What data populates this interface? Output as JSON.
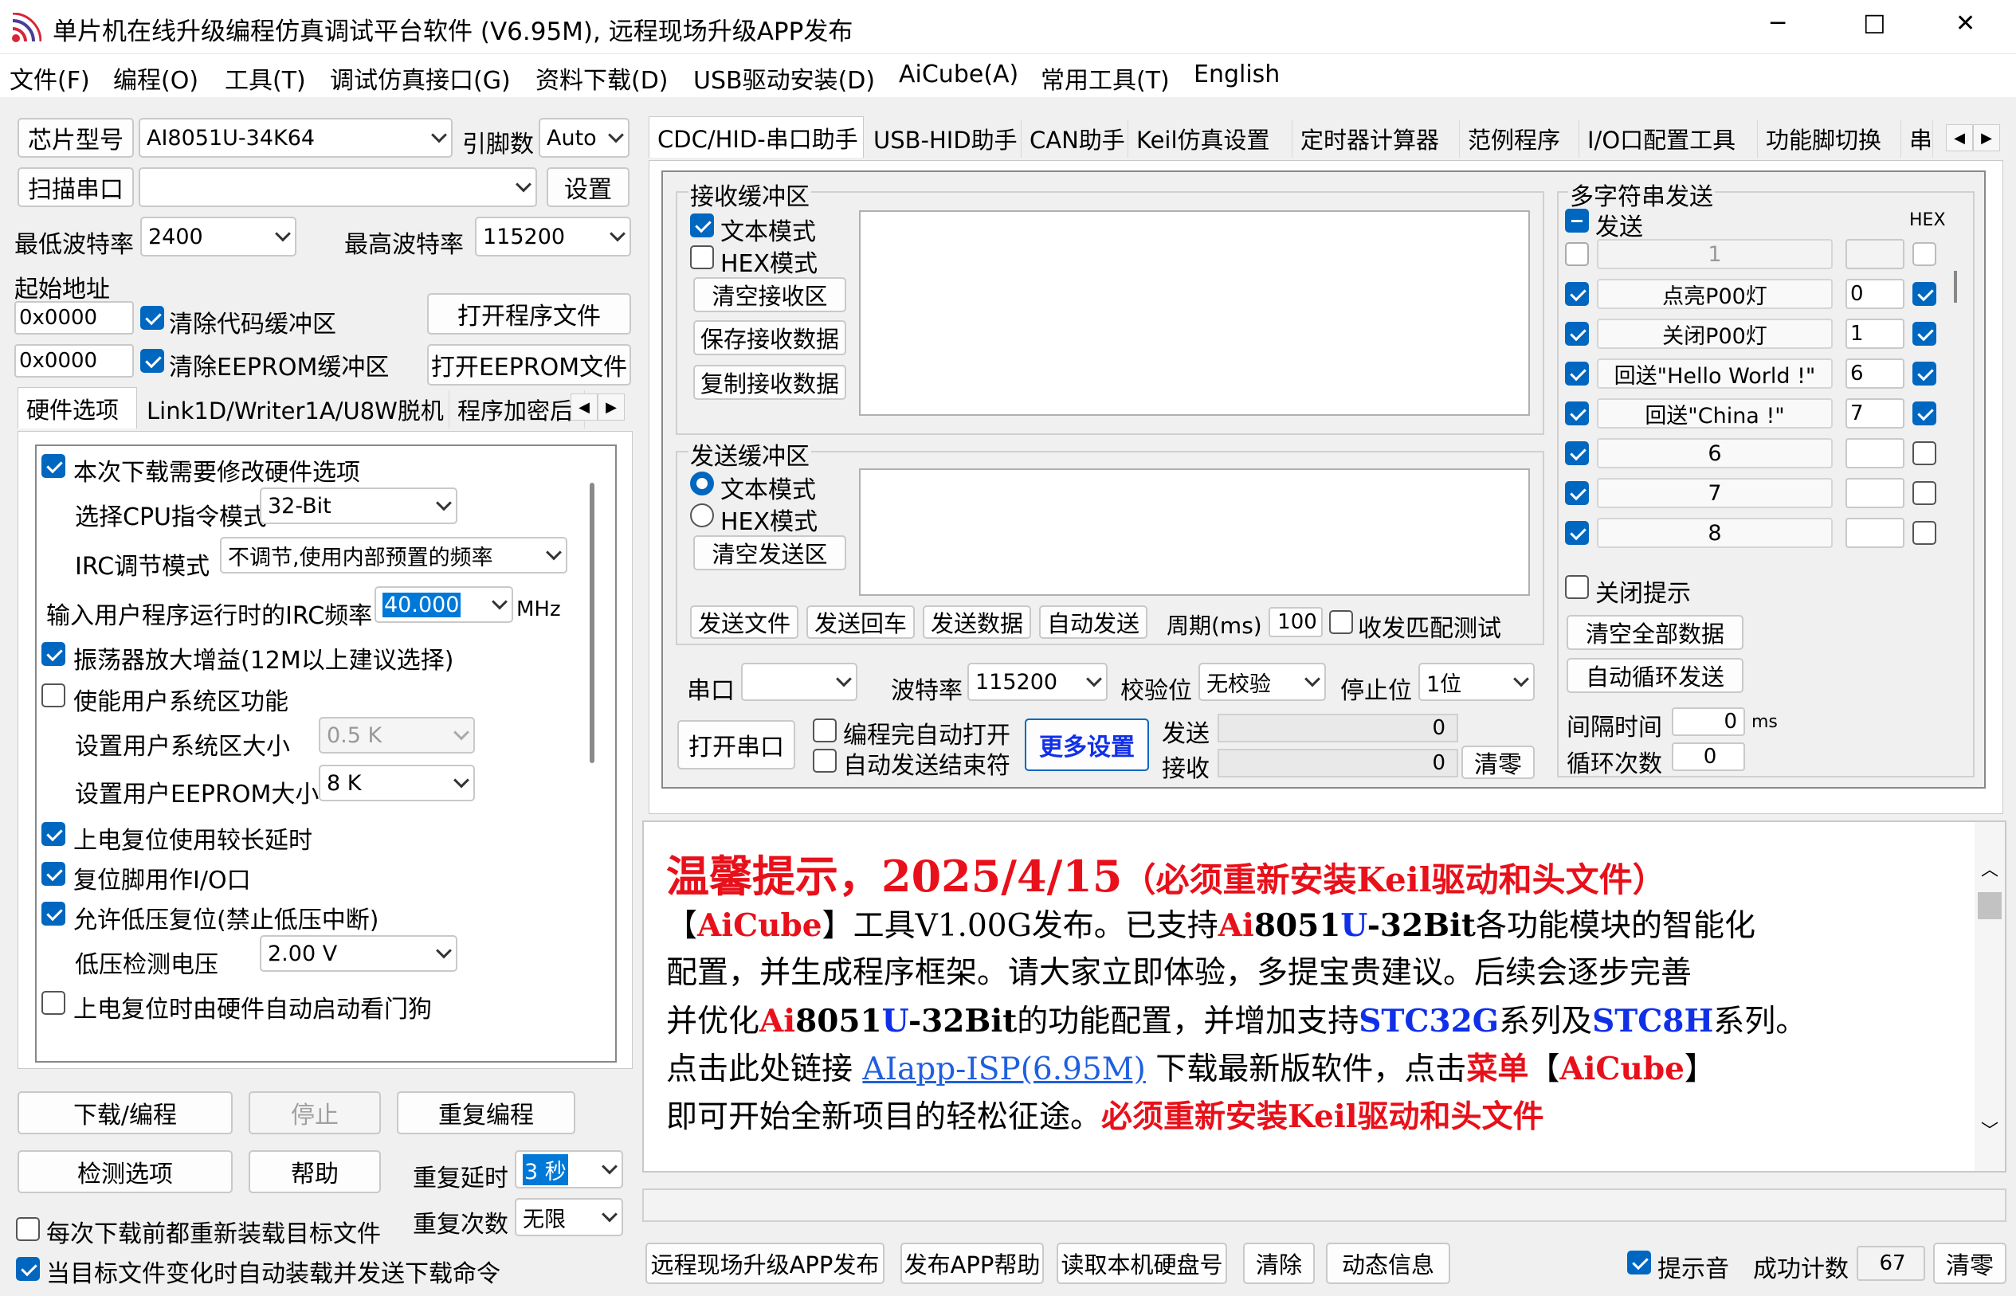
{
  "window": {
    "title": "单片机在线升级编程仿真调试平台软件 (V6.95M), 远程现场升级APP发布",
    "min": "─",
    "max": "☐",
    "close": "✕"
  },
  "menu": [
    "文件(F)",
    "编程(O)",
    "工具(T)",
    "调试仿真接口(G)",
    "资料下载(D)",
    "USB驱动安装(D)",
    "AiCube(A)",
    "常用工具(T)",
    "English"
  ],
  "left": {
    "chip_btn": "芯片型号",
    "chip_value": "AI8051U-34K64",
    "pins_label": "引脚数",
    "pins_value": "Auto",
    "scan_btn": "扫描串口",
    "port_value": "",
    "settings_btn": "设置",
    "min_baud_label": "最低波特率",
    "min_baud": "2400",
    "max_baud_label": "最高波特率",
    "max_baud": "115200",
    "start_addr_label": "起始地址",
    "addr1": "0x0000",
    "clear_code": "清除代码缓冲区",
    "open_prog": "打开程序文件",
    "addr2": "0x0000",
    "clear_eeprom": "清除EEPROM缓冲区",
    "open_eeprom": "打开EEPROM文件",
    "tabs": [
      "硬件选项",
      "Link1D/Writer1A/U8W脱机",
      "程序加密后"
    ],
    "hw": {
      "modify": "本次下载需要修改硬件选项",
      "cpu_mode_label": "选择CPU指令模式",
      "cpu_mode": "32-Bit",
      "irc_mode_label": "IRC调节模式",
      "irc_mode": "不调节,使用内部预置的频率",
      "irc_freq_label": "输入用户程序运行时的IRC频率",
      "irc_freq": "40.000",
      "irc_unit": "MHz",
      "osc": "振荡器放大增益(12M以上建议选择)",
      "user_sys": "使能用户系统区功能",
      "user_sys_size_label": "设置用户系统区大小",
      "user_sys_size": "0.5 K",
      "user_eeprom_label": "设置用户EEPROM大小",
      "user_eeprom": "8   K",
      "long_delay": "上电复位使用较长延时",
      "reset_io": "复位脚用作I/O口",
      "lvr": "允许低压复位(禁止低压中断)",
      "lvd_label": "低压检测电压",
      "lvd": "2.00 V",
      "wdt": "上电复位时由硬件自动启动看门狗"
    },
    "download_btn": "下载/编程",
    "stop_btn": "停止",
    "repeat_btn": "重复编程",
    "check_btn": "检测选项",
    "help_btn": "帮助",
    "repeat_delay_label": "重复延时",
    "repeat_delay": "3 秒",
    "repeat_count_label": "重复次数",
    "repeat_count": "无限",
    "reload_each": "每次下载前都重新装载目标文件",
    "auto_reload": "当目标文件变化时自动装载并发送下载命令"
  },
  "right": {
    "tabs": [
      "CDC/HID-串口助手",
      "USB-HID助手",
      "CAN助手",
      "Keil仿真设置",
      "定时器计算器",
      "范例程序",
      "I/O口配置工具",
      "功能脚切换",
      "串"
    ],
    "recv_title": "接收缓冲区",
    "recv_text": "文本模式",
    "recv_hex": "HEX模式",
    "clear_recv": "清空接收区",
    "save_recv": "保存接收数据",
    "copy_recv": "复制接收数据",
    "send_title": "发送缓冲区",
    "send_text": "文本模式",
    "send_hex": "HEX模式",
    "clear_send": "清空发送区",
    "send_file": "发送文件",
    "send_cr": "发送回车",
    "send_data": "发送数据",
    "auto_send": "自动发送",
    "period_label": "周期(ms)",
    "period": "100",
    "match_test": "收发匹配测试",
    "port_label": "串口",
    "port": "",
    "baud_label": "波特率",
    "baud": "115200",
    "parity_label": "校验位",
    "parity": "无校验",
    "stop_label": "停止位",
    "stop": "1位",
    "open_port": "打开串口",
    "auto_open": "编程完自动打开",
    "auto_send_end": "自动发送结束符",
    "more_settings": "更多设置",
    "send_label": "发送",
    "send_count": "0",
    "recv_label": "接收",
    "recv_count": "0",
    "clear_btn": "清零",
    "multi": {
      "title": "多字符串发送",
      "send": "发送",
      "hex": "HEX",
      "rows": [
        {
          "label": "1",
          "value": "",
          "chk": false,
          "hexchk": false,
          "dim": true
        },
        {
          "label": "点亮P00灯",
          "value": "0",
          "chk": true,
          "hexchk": true
        },
        {
          "label": "关闭P00灯",
          "value": "1",
          "chk": true,
          "hexchk": true
        },
        {
          "label": "回送\"Hello World !\"",
          "value": "6",
          "chk": true,
          "hexchk": true
        },
        {
          "label": "回送\"China !\"",
          "value": "7",
          "chk": true,
          "hexchk": true
        },
        {
          "label": "6",
          "value": "",
          "chk": true,
          "hexchk": false
        },
        {
          "label": "7",
          "value": "",
          "chk": true,
          "hexchk": false
        },
        {
          "label": "8",
          "value": "",
          "chk": true,
          "hexchk": false
        }
      ],
      "close_tip": "关闭提示",
      "clear_all": "清空全部数据",
      "auto_loop": "自动循环发送",
      "interval_label": "间隔时间",
      "interval": "0",
      "interval_unit": "ms",
      "loop_label": "循环次数",
      "loop": "0"
    },
    "notice": {
      "head1": "温馨提示，2025/4/15",
      "head2": "（必须重新安装Keil驱动和头文件）",
      "l2a": "【",
      "l2b": "AiCube",
      "l2c": "】工具V1.00G发布。已支持",
      "l2d": "Ai",
      "l2e": "8051",
      "l2f": "U",
      "l2g": "-32Bit",
      "l2h": "各功能模块的智能化",
      "l3": "配置，并生成程序框架。请大家立即体验，多提宝贵建议。后续会逐步完善",
      "l4a": "并优化",
      "l4b": "Ai",
      "l4c": "8051",
      "l4d": "U",
      "l4e": "-32Bit",
      "l4f": "的功能配置，并增加支持",
      "l4g": "STC32G",
      "l4h": "系列及",
      "l4i": "STC8H",
      "l4j": "系列。",
      "l5a": "点击此处链接 ",
      "l5b": "AIapp-ISP(6.95M)",
      "l5c": " 下载最新版软件，点击",
      "l5d": "菜单",
      "l5e": "【",
      "l5f": "AiCube",
      "l5g": "】",
      "l6a": "即可开始全新项目的轻松征途。",
      "l6b": "必须重新安装Keil驱动和头文件"
    },
    "remote_btn": "远程现场升级APP发布",
    "publish_help": "发布APP帮助",
    "read_disk": "读取本机硬盘号",
    "clear": "清除",
    "dyn_info": "动态信息",
    "beep": "提示音",
    "success_label": "成功计数",
    "success": "67",
    "zero": "清零"
  },
  "colors": {
    "accent": "#0067c0",
    "red": "#e8101a",
    "blue": "#1030e8"
  }
}
